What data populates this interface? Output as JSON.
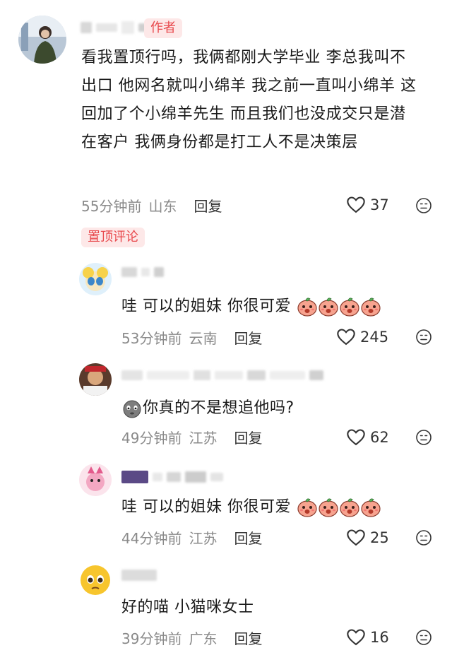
{
  "main_comment": {
    "author_tag": "作者",
    "text": "看我置顶行吗，我俩都刚大学毕业 李总我叫不出口 他网名就叫小绵羊 我之前一直叫小绵羊 这回加了个小绵羊先生 而且我们也没成交只是潜在客户 我俩身份都是打工人不是决策层",
    "time": "55分钟前",
    "location": "山东",
    "reply_label": "回复",
    "likes": "37"
  },
  "pinned_label": "置顶评论",
  "replies": [
    {
      "text": "哇 可以的姐妹 你很可爱",
      "time": "53分钟前",
      "location": "云南",
      "reply_label": "回复",
      "likes": "245"
    },
    {
      "text": "你真的不是想追他吗?",
      "time": "49分钟前",
      "location": "江苏",
      "reply_label": "回复",
      "likes": "62"
    },
    {
      "text": "哇 可以的姐妹 你很可爱",
      "time": "44分钟前",
      "location": "江苏",
      "reply_label": "回复",
      "likes": "25"
    },
    {
      "text": "好的喵 小猫咪女士",
      "time": "39分钟前",
      "location": "广东",
      "reply_label": "回复",
      "likes": "16"
    }
  ],
  "icons": {
    "heart": "heart-outline-icon",
    "dislike": "dislike-face-icon",
    "sticker": "peach-sticker-icon"
  }
}
